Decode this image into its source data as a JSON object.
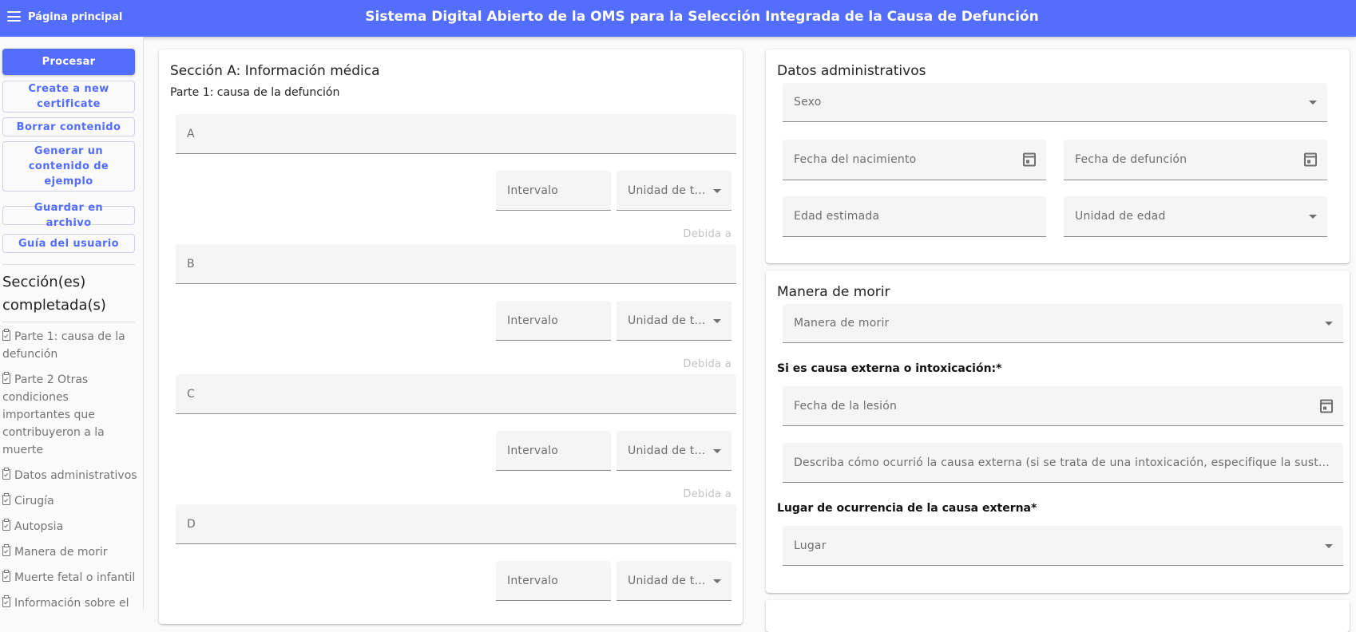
{
  "header": {
    "home_label": "Página principal",
    "title": "Sistema Digital Abierto de la OMS para la Selección Integrada de la Causa de Defunción",
    "bar_color": "#536dfe"
  },
  "sidebar": {
    "process_label": "Procesar",
    "new_certificate_label": "Create a new certificate",
    "clear_label": "Borrar contenido",
    "sample_label": "Generar un contenido de ejemplo",
    "save_label": "Guardar en archivo",
    "guide_label": "Guía del usuario",
    "completed_heading": "Sección(es) completada(s)",
    "completed_items": [
      "Parte 1: causa de la defunción",
      "Parte 2 Otras condiciones importantes que contribuyeron a la muerte",
      "Datos administrativos",
      "Cirugía",
      "Autopsia",
      "Manera de morir",
      "Muerte fetal o infantil",
      "Información sobre el embarazo"
    ],
    "item_icon": "clipboard-check-icon"
  },
  "section_a": {
    "title": "Sección A: Información médica",
    "subtitle": "Parte 1: causa de la defunción",
    "rows": [
      {
        "label": "A",
        "interval": "Intervalo",
        "unit": "Unidad de ti...",
        "due_to": "Debida a"
      },
      {
        "label": "B",
        "interval": "Intervalo",
        "unit": "Unidad de ti...",
        "due_to": "Debida a"
      },
      {
        "label": "C",
        "interval": "Intervalo",
        "unit": "Unidad de ti...",
        "due_to": "Debida a"
      },
      {
        "label": "D",
        "interval": "Intervalo",
        "unit": "Unidad de ti..."
      }
    ]
  },
  "admin": {
    "title": "Datos administrativos",
    "sex": "Sexo",
    "birth_date": "Fecha del nacimiento",
    "death_date": "Fecha de defunción",
    "estimated_age": "Edad estimada",
    "age_unit": "Unidad de edad"
  },
  "manner": {
    "title": "Manera de morir",
    "select": "Manera de morir",
    "external_label": "Si es causa externa o intoxicación:*",
    "injury_date": "Fecha de la lesión",
    "describe": "Describa cómo ocurrió la causa externa (si se trata de una intoxicación, especifique la sustancia)",
    "place_label": "Lugar de ocurrencia de la causa externa*",
    "place": "Lugar"
  }
}
